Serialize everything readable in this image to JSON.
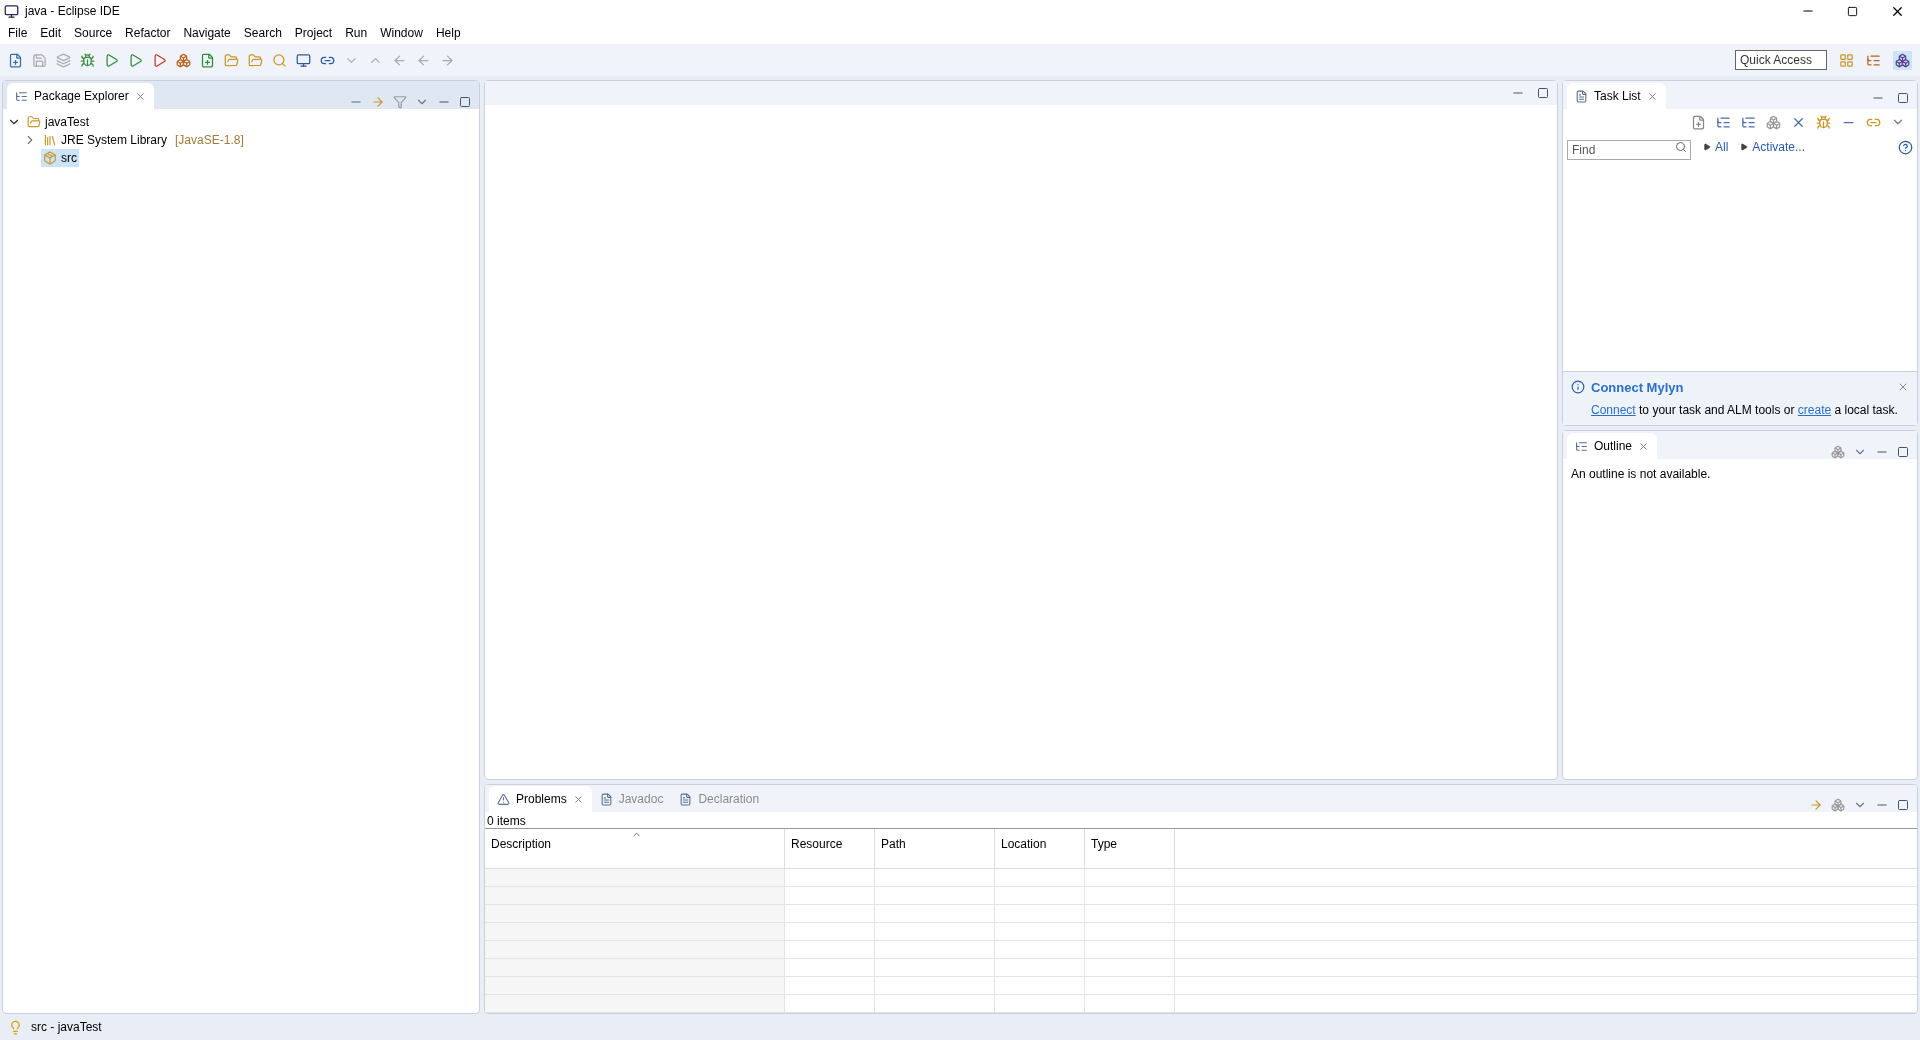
{
  "window": {
    "title": "java - Eclipse IDE"
  },
  "menu": [
    "File",
    "Edit",
    "Source",
    "Refactor",
    "Navigate",
    "Search",
    "Project",
    "Run",
    "Window",
    "Help"
  ],
  "quick_access": {
    "placeholder": "Quick Access"
  },
  "package_explorer": {
    "tab": {
      "label": "Package Explorer",
      "selected": true
    },
    "tree": [
      {
        "label": "javaTest",
        "kind": "project",
        "expanded": true,
        "selected": false,
        "children": [
          {
            "label": "JRE System Library",
            "suffix": "[JavaSE-1.8]",
            "kind": "library",
            "expanded": false,
            "selected": false
          },
          {
            "label": "src",
            "kind": "folder",
            "selected": true
          }
        ]
      }
    ]
  },
  "task_list": {
    "tab": {
      "label": "Task List",
      "selected": true
    },
    "find": {
      "placeholder": "Find"
    },
    "filters": [
      "All",
      "Activate..."
    ],
    "mylyn": {
      "title": "Connect Mylyn",
      "message": [
        {
          "text": "Connect",
          "link": true
        },
        {
          "text": " to your task and ALM tools or ",
          "link": false
        },
        {
          "text": "create",
          "link": true
        },
        {
          "text": " a local task.",
          "link": false
        }
      ]
    }
  },
  "outline": {
    "tab": {
      "label": "Outline",
      "selected": true
    },
    "message": "An outline is not available."
  },
  "bottom": {
    "tabs": [
      {
        "label": "Problems",
        "selected": true
      },
      {
        "label": "Javadoc",
        "selected": false
      },
      {
        "label": "Declaration",
        "selected": false
      }
    ],
    "count": "0 items",
    "columns": [
      "Description",
      "Resource",
      "Path",
      "Location",
      "Type"
    ]
  },
  "status_bar": {
    "text": "src - javaTest"
  }
}
